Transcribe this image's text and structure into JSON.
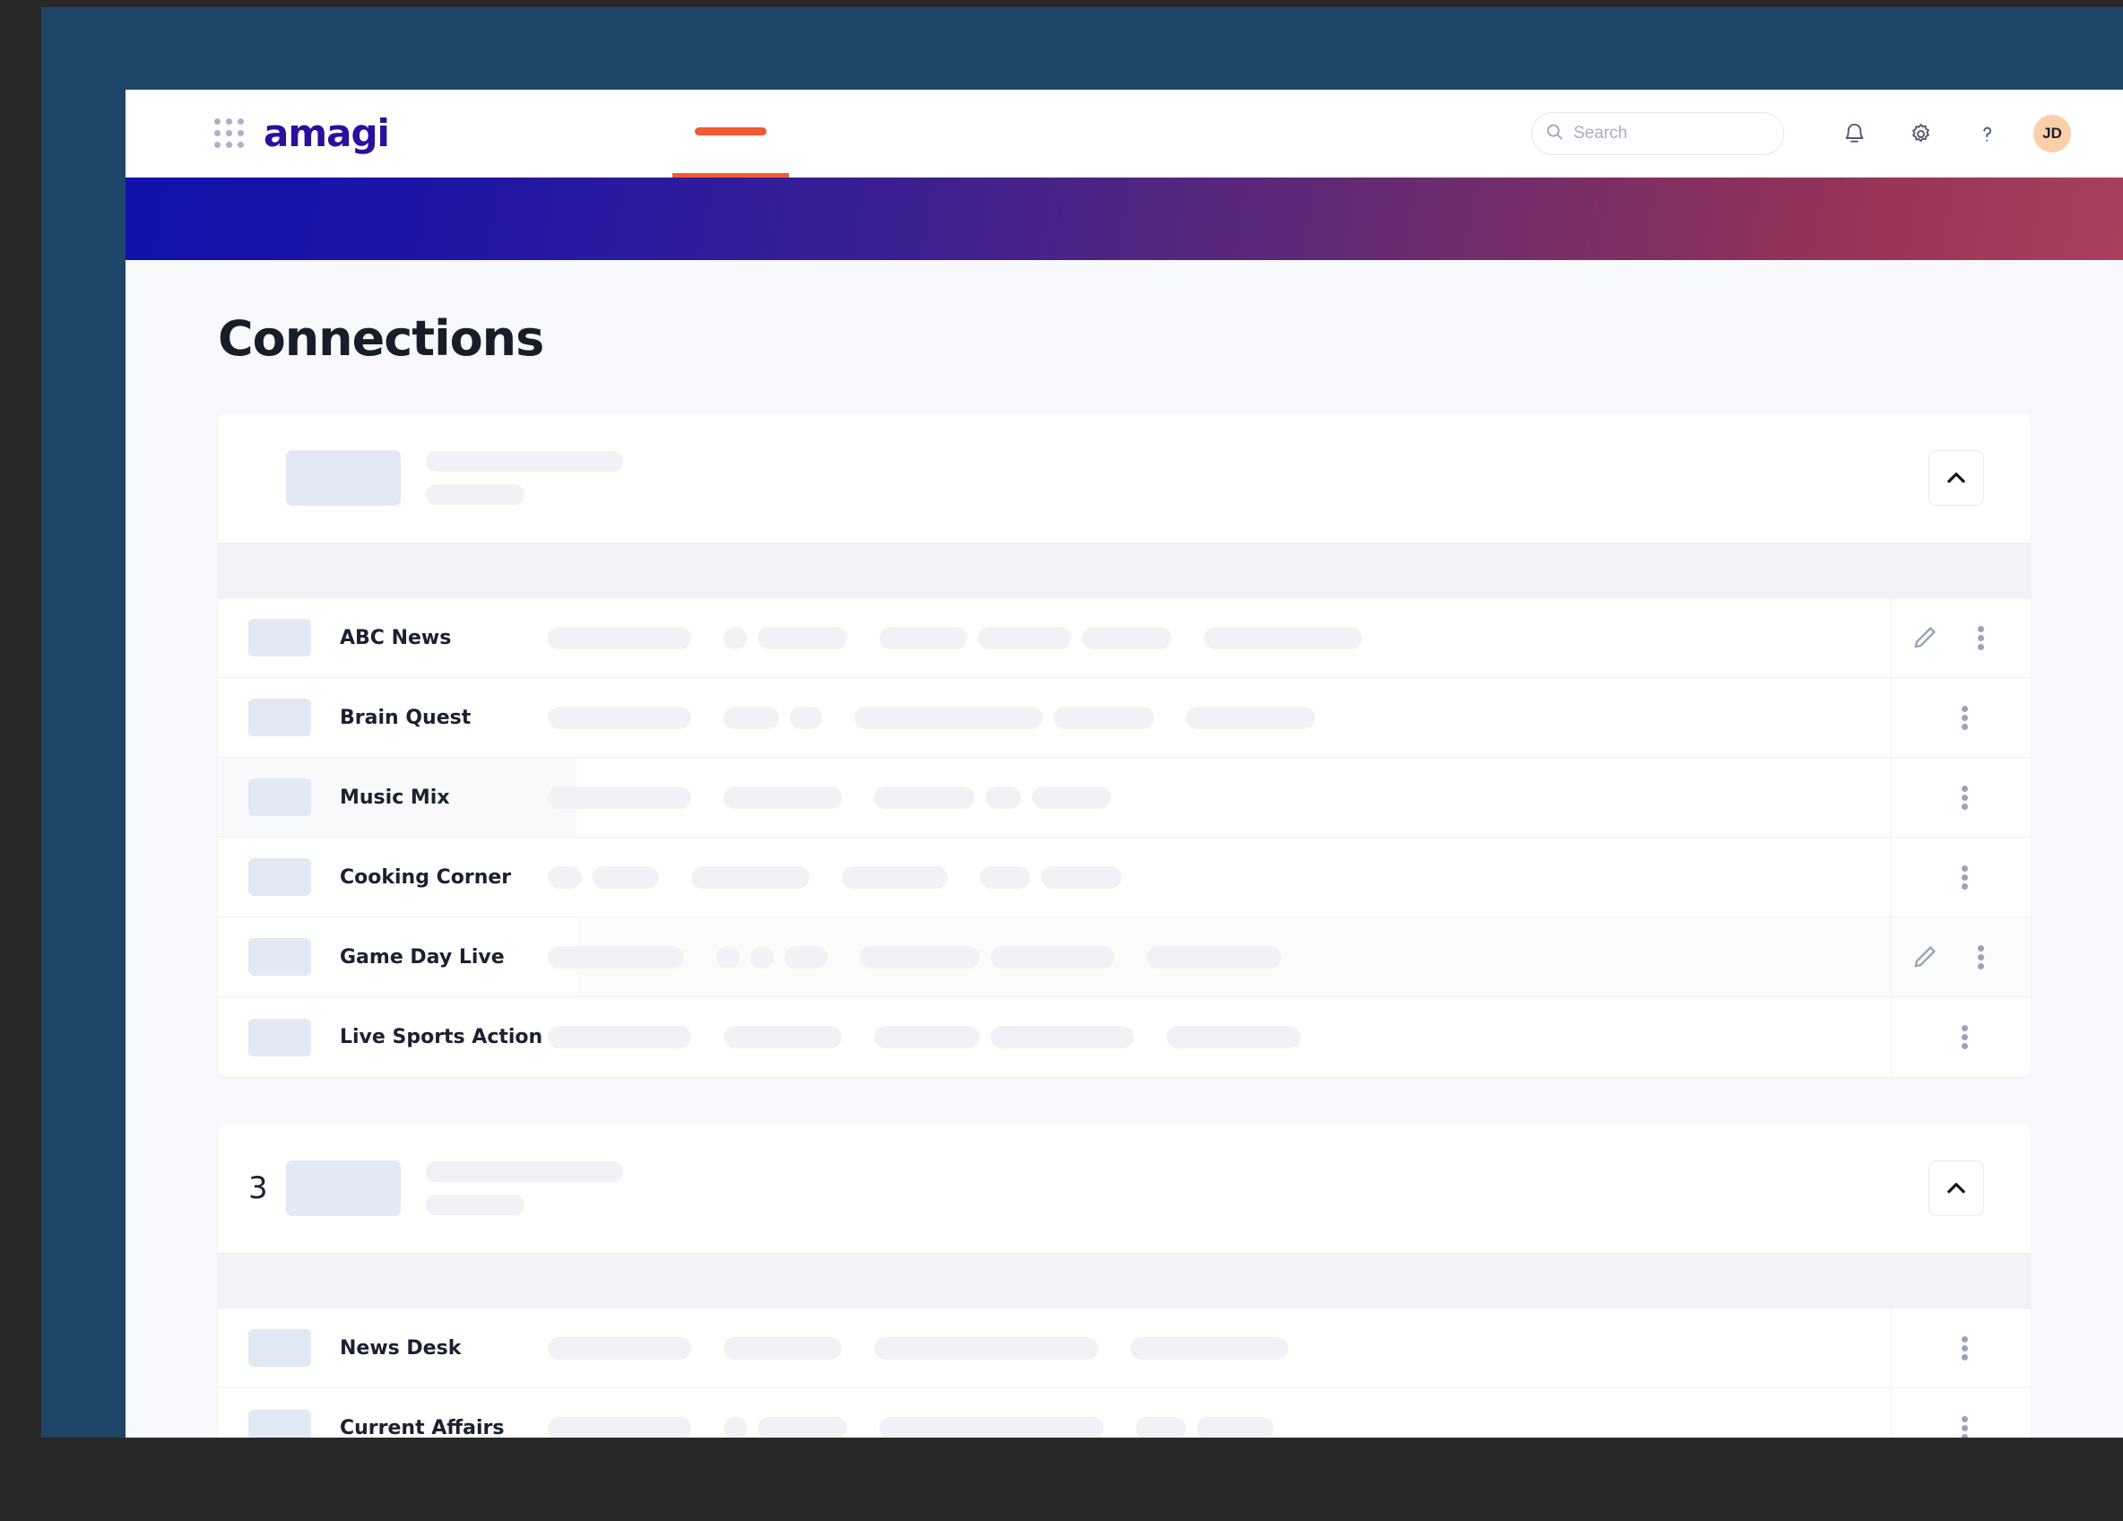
{
  "header": {
    "brand": "amagi",
    "grid_icon": "apps-grid-icon",
    "nav_tab_active": true,
    "search": {
      "value": "",
      "placeholder": "Search",
      "icon": "search-icon"
    },
    "icons": [
      {
        "name": "bell-icon",
        "label": "Notifications"
      },
      {
        "name": "gear-icon",
        "label": "Settings"
      },
      {
        "name": "help-icon",
        "label": "Help"
      }
    ],
    "avatar_initials": "JD"
  },
  "banner": {
    "gradient_start": "#1111ab",
    "gradient_end": "#a8405c"
  },
  "page": {
    "title": "Connections"
  },
  "cards": [
    {
      "count": "",
      "collapse_icon": "chevron-up-icon",
      "header_skeletons": [
        220,
        110
      ],
      "rows": [
        {
          "name": "ABC News",
          "highlight": "none",
          "has_edit": true,
          "skeletons": [
            [
              160
            ],
            [
              26,
              100
            ],
            [
              98,
              104,
              100
            ],
            [
              176
            ]
          ]
        },
        {
          "name": "Brain Quest",
          "highlight": "none",
          "has_edit": false,
          "skeletons": [
            [
              160
            ],
            [
              62,
              36
            ],
            [
              210,
              112
            ],
            [
              144
            ]
          ]
        },
        {
          "name": "Music Mix",
          "highlight": "left",
          "has_edit": false,
          "skeletons": [
            [
              160
            ],
            [
              132
            ],
            [
              112,
              40,
              88
            ]
          ]
        },
        {
          "name": "Cooking Corner",
          "highlight": "none",
          "has_edit": false,
          "skeletons": [
            [
              38,
              74
            ],
            [
              132
            ],
            [
              118
            ],
            [
              56,
              90
            ]
          ]
        },
        {
          "name": "Game Day Live",
          "highlight": "right",
          "has_edit": true,
          "skeletons": [
            [
              152
            ],
            [
              26,
              26,
              48
            ],
            [
              134,
              138
            ],
            [
              150
            ]
          ]
        },
        {
          "name": "Live Sports Action",
          "highlight": "none",
          "has_edit": false,
          "skeletons": [
            [
              160
            ],
            [
              132
            ],
            [
              118,
              160
            ],
            [
              150
            ]
          ]
        }
      ]
    },
    {
      "count": "3",
      "collapse_icon": "chevron-up-icon",
      "header_skeletons": [
        220,
        110
      ],
      "rows": [
        {
          "name": "News Desk",
          "highlight": "none",
          "has_edit": false,
          "skeletons": [
            [
              160
            ],
            [
              132
            ],
            [
              250
            ],
            [
              176
            ]
          ]
        },
        {
          "name": "Current Affairs",
          "highlight": "none",
          "has_edit": false,
          "skeletons": [
            [
              160
            ],
            [
              26,
              100
            ],
            [
              250
            ],
            [
              56,
              86
            ]
          ]
        }
      ]
    }
  ]
}
